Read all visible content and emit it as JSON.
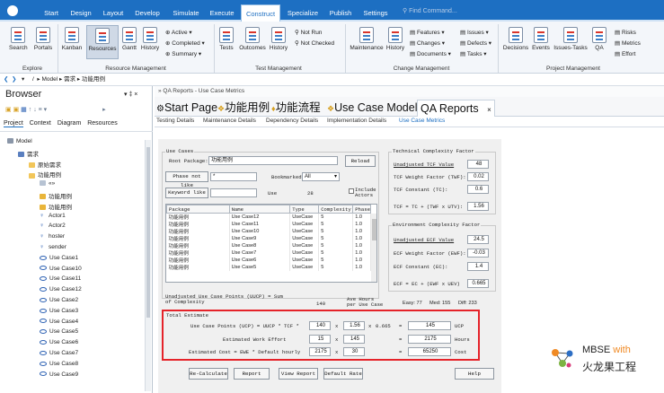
{
  "menu": {
    "tabs": [
      "Start",
      "Design",
      "Layout",
      "Develop",
      "Simulate",
      "Execute",
      "Construct",
      "Specialize",
      "Publish",
      "Settings"
    ],
    "active": "Construct",
    "find_placeholder": "Find Command..."
  },
  "ribbon": {
    "explore": {
      "label": "Explore",
      "buttons": [
        "Search",
        "Portals"
      ]
    },
    "resource": {
      "label": "Resource Management",
      "buttons": [
        "Kanban",
        "Resources",
        "Gantt",
        "History"
      ],
      "small": [
        "Active",
        "Completed",
        "Summary"
      ]
    },
    "test": {
      "label": "Test Management",
      "buttons": [
        "Tests",
        "Outcomes",
        "History"
      ],
      "small": [
        "Not Run",
        "Not Checked"
      ]
    },
    "change": {
      "label": "Change Management",
      "buttons": [
        "Maintenance",
        "History"
      ],
      "small": [
        "Features",
        "Changes",
        "Documents",
        "Issues",
        "Defects",
        "Tasks"
      ]
    },
    "project": {
      "label": "Project Management",
      "buttons": [
        "Decisions",
        "Events",
        "Issues-Tasks",
        "QA"
      ],
      "small": [
        "Risks",
        "Metrics",
        "Effort"
      ]
    }
  },
  "breadcrumb": [
    "Model",
    "需求",
    "功能用例"
  ],
  "browser": {
    "title": "Browser",
    "tabs": [
      "Project",
      "Context",
      "Diagram",
      "Resources"
    ],
    "tree": [
      {
        "label": "Model",
        "kind": "root",
        "indent": 0
      },
      {
        "label": "需求",
        "kind": "pkg",
        "indent": 1
      },
      {
        "label": "原始需求",
        "kind": "folder",
        "indent": 2
      },
      {
        "label": "功能用例",
        "kind": "folder",
        "indent": 2
      },
      {
        "label": "«»",
        "kind": "misc",
        "indent": 3
      },
      {
        "label": "功能用例",
        "kind": "diagram",
        "indent": 3
      },
      {
        "label": "功能用例",
        "kind": "diagram",
        "indent": 3
      },
      {
        "label": "Actor1",
        "kind": "actor",
        "indent": 3
      },
      {
        "label": "Actor2",
        "kind": "actor",
        "indent": 3
      },
      {
        "label": "hoster",
        "kind": "actor",
        "indent": 3
      },
      {
        "label": "sender",
        "kind": "actor",
        "indent": 3
      },
      {
        "label": "Use Case1",
        "kind": "uc",
        "indent": 3
      },
      {
        "label": "Use Case10",
        "kind": "uc",
        "indent": 3
      },
      {
        "label": "Use Case11",
        "kind": "uc",
        "indent": 3
      },
      {
        "label": "Use Case12",
        "kind": "uc",
        "indent": 3
      },
      {
        "label": "Use Case2",
        "kind": "uc",
        "indent": 3
      },
      {
        "label": "Use Case3",
        "kind": "uc",
        "indent": 3
      },
      {
        "label": "Use Case4",
        "kind": "uc",
        "indent": 3
      },
      {
        "label": "Use Case5",
        "kind": "uc",
        "indent": 3
      },
      {
        "label": "Use Case6",
        "kind": "uc",
        "indent": 3
      },
      {
        "label": "Use Case7",
        "kind": "uc",
        "indent": 3
      },
      {
        "label": "Use Case8",
        "kind": "uc",
        "indent": 3
      },
      {
        "label": "Use Case9",
        "kind": "uc",
        "indent": 3
      }
    ]
  },
  "pane_header": "QA Reports - Use Case Metrics",
  "doctabs": [
    "Start Page",
    "功能用例",
    "功能流程",
    "Use Case Model",
    "QA Reports"
  ],
  "subtabs": [
    "Testing Details",
    "Maintenance Details",
    "Dependency Details",
    "Implementation Details",
    "Use Case Metrics"
  ],
  "metrics": {
    "use_cases": {
      "group": "Use Cases",
      "root_label": "Root Package:",
      "root_value": "功能用例",
      "reload": "Reload",
      "phase_btn": "Phase not like",
      "phase_value": "*",
      "bookmarked_label": "Bookmarked:",
      "bookmarked_value": "All",
      "keyword_btn": "Keyword like",
      "use_label": "Use",
      "use_count": "28",
      "include_actors": "Include Actors"
    },
    "table": {
      "headers": [
        "Package",
        "Name",
        "Type",
        "Complexity",
        "Phase"
      ],
      "rows": [
        [
          "功能用例",
          "Use Case12",
          "UseCase",
          "5",
          "1.0"
        ],
        [
          "功能用例",
          "Use Case11",
          "UseCase",
          "5",
          "1.0"
        ],
        [
          "功能用例",
          "Use Case10",
          "UseCase",
          "5",
          "1.0"
        ],
        [
          "功能用例",
          "Use Case9",
          "UseCase",
          "5",
          "1.0"
        ],
        [
          "功能用例",
          "Use Case8",
          "UseCase",
          "5",
          "1.0"
        ],
        [
          "功能用例",
          "Use Case7",
          "UseCase",
          "5",
          "1.0"
        ],
        [
          "功能用例",
          "Use Case6",
          "UseCase",
          "5",
          "1.0"
        ],
        [
          "功能用例",
          "Use Case5",
          "UseCase",
          "5",
          "1.0"
        ]
      ]
    },
    "uucp": {
      "label": "Unadjusted Use Case Points (UUCP) = Sum of Complexity",
      "value": "140",
      "ave_label": "Ave Hours per Use Case",
      "easy": "Easy: 77",
      "med": "Med: 155",
      "diff": "Diff: 233"
    },
    "tcf": {
      "group": "Technical Complexity Factor",
      "unadj_label": "Unadjusted TCF Value",
      "unadj": "48",
      "weight_label": "TCF Weight Factor (TWF):",
      "weight": "0.02",
      "const_label": "TCF Constant (TC):",
      "const": "0.6",
      "formula": "TCF = TC + (TWF x UTV):",
      "value": "1.56"
    },
    "ecf": {
      "group": "Environment Complexity Factor",
      "unadj_label": "Unadjusted ECF Value",
      "unadj": "24.5",
      "weight_label": "ECF Weight Factor (EWF):",
      "weight": "-0.03",
      "const_label": "ECF Constant (EC):",
      "const": "1.4",
      "formula": "ECF = EC + (EWF x UEV)",
      "value": "0.665"
    },
    "total": {
      "group": "Total Estimate",
      "ucp_label": "Use Case Points (UCP) = UUCP * TCF *",
      "ucp_a": "140",
      "ucp_b": "1.56",
      "ucp_c": "0.665",
      "ucp_value": "145",
      "ucp_unit": "UCP",
      "effort_label": "Estimated Work Effort",
      "effort_a": "15",
      "effort_b": "145",
      "effort_value": "2175",
      "effort_unit": "Hours",
      "cost_label": "Estimated Cost = EWE * Default hourly",
      "cost_a": "2175",
      "cost_b": "30",
      "cost_value": "65250",
      "cost_unit": "Cost",
      "op_x": "x",
      "op_eq": "="
    },
    "buttons": [
      "Re-Calculate",
      "Report",
      "View Report",
      "Default Rate",
      "Help"
    ]
  },
  "logo": {
    "line1": "MBSE",
    "line1b": "with",
    "line2": "火龙果工程"
  }
}
